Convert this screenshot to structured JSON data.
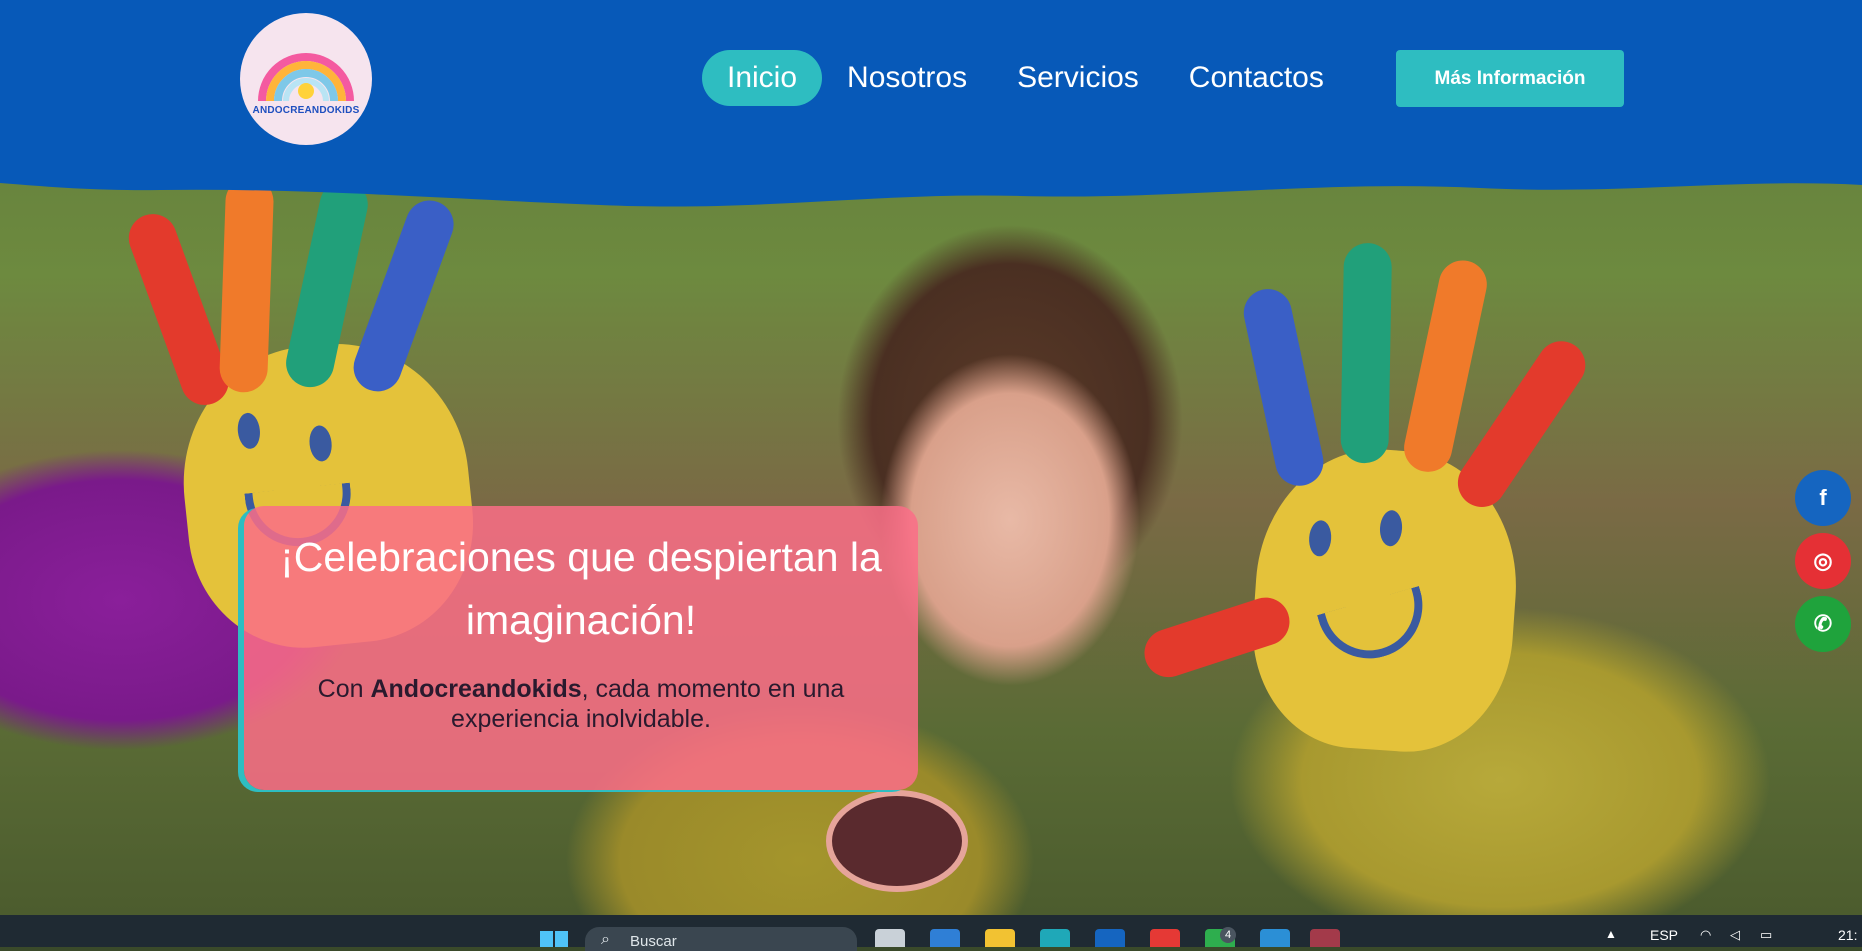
{
  "brand": {
    "name": "ANDOCREANDOKIDS"
  },
  "nav": {
    "items": [
      {
        "label": "Inicio",
        "active": true
      },
      {
        "label": "Nosotros",
        "active": false
      },
      {
        "label": "Servicios",
        "active": false
      },
      {
        "label": "Contactos",
        "active": false
      }
    ],
    "cta_label": "Más Información"
  },
  "hero": {
    "title": "¡Celebraciones que despiertan la imaginación!",
    "text_prefix": "Con ",
    "text_brand": "Andocreandokids",
    "text_suffix": ", cada momento en una experiencia inolvidable."
  },
  "social": [
    {
      "name": "facebook",
      "icon": "facebook-icon",
      "glyph": "f",
      "color": "#1565c0"
    },
    {
      "name": "instagram",
      "icon": "instagram-icon",
      "glyph": "◎",
      "color": "#e53035"
    },
    {
      "name": "whatsapp",
      "icon": "whatsapp-icon",
      "glyph": "✆",
      "color": "#1fa33c"
    }
  ],
  "taskbar": {
    "search_placeholder": "Buscar",
    "badge_count": "4",
    "language": "ESP",
    "time": "21:"
  },
  "colors": {
    "header_blue": "#0759b8",
    "accent_teal": "#2ebdc1",
    "card_pink": "#fa6e87"
  }
}
